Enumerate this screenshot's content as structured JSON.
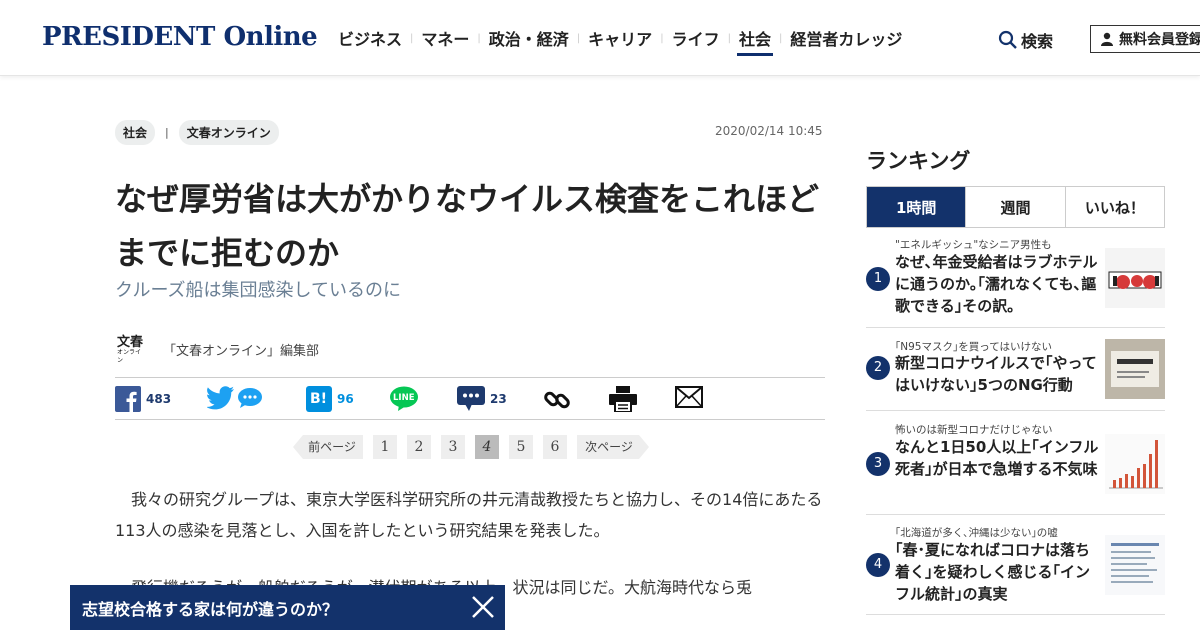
{
  "header": {
    "logo": "PRESIDENT Online",
    "nav": [
      {
        "label": "ビジネス",
        "active": false
      },
      {
        "label": "マネー",
        "active": false
      },
      {
        "label": "政治・経済",
        "active": false
      },
      {
        "label": "キャリア",
        "active": false
      },
      {
        "label": "ライフ",
        "active": false
      },
      {
        "label": "社会",
        "active": true
      },
      {
        "label": "経営者カレッジ",
        "active": false
      }
    ],
    "search_label": "検索",
    "member_label": "無料会員登録"
  },
  "article": {
    "tags": [
      "社会",
      "文春オンライン"
    ],
    "tag_separator": "|",
    "date": "2020/02/14 10:45",
    "title": "なぜ厚労省は大がかりなウイルス検査をこれほどまでに拒むのか",
    "subtitle": "クルーズ船は集団感染しているのに",
    "author_logo_top": "文春",
    "author_logo_bottom": "オンライン",
    "author": "「文春オンライン」編集部",
    "paragraphs": [
      "我々の研究グループは、東京大学医科学研究所の井元清哉教授たちと協力し、その14倍にあたる113人の感染を見落とし、入国を許したという研究結果を発表した。",
      "飛行機だろうが、船舶だろうが、潜伏期がある以上、状況は同じだ。大航海時代なら兎"
    ]
  },
  "share": {
    "facebook_count": "483",
    "hatena_count": "96",
    "comment_count": "23",
    "hatena_label": "B!",
    "line_label": "LINE"
  },
  "pager": {
    "prev": "前ページ",
    "next": "次ページ",
    "pages": [
      "1",
      "2",
      "3",
      "4",
      "5",
      "6"
    ],
    "current": "4"
  },
  "banner": {
    "text": "志望校合格する家は何が違うのか？"
  },
  "ranking": {
    "title": "ランキング",
    "tabs": [
      "1時間",
      "週間",
      "いいね！"
    ],
    "active_tab": "1時間",
    "items": [
      {
        "num": "1",
        "kicker": "\"エネルギッシュ\"なシニア男性も",
        "headline": "なぜ､年金受給者はラブホテルに通うのか｡｢濡れなくても､謳歌できる｣その訳｡"
      },
      {
        "num": "2",
        "kicker": "｢N95マスク｣を買ってはいけない",
        "headline": "新型コロナウイルスで｢やってはいけない｣5つのNG行動"
      },
      {
        "num": "3",
        "kicker": "怖いのは新型コロナだけじゃない",
        "headline": "なんと1日50人以上｢インフル死者｣が日本で急増する不気味"
      },
      {
        "num": "4",
        "kicker": "｢北海道が多く､沖縄は少ない｣の嘘",
        "headline": "｢春･夏になればコロナは落ち着く｣を疑わしく感じる｢インフル統計｣の真実"
      }
    ]
  },
  "colors": {
    "brand_navy": "#13326b",
    "facebook": "#3b5998",
    "twitter": "#1da1f2",
    "hatena": "#008fde",
    "line": "#06c755"
  }
}
